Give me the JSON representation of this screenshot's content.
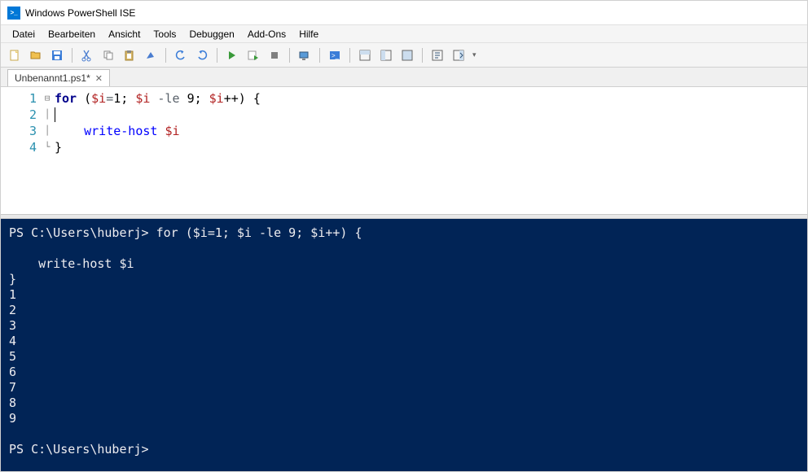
{
  "window": {
    "title": "Windows PowerShell ISE"
  },
  "menu": {
    "items": [
      "Datei",
      "Bearbeiten",
      "Ansicht",
      "Tools",
      "Debuggen",
      "Add-Ons",
      "Hilfe"
    ]
  },
  "tab": {
    "label": "Unbenannt1.ps1*"
  },
  "editor": {
    "line_numbers": [
      "1",
      "2",
      "3",
      "4"
    ],
    "code_lines": [
      {
        "tokens": [
          {
            "t": "for ",
            "c": "kw"
          },
          {
            "t": "(",
            "c": "plain"
          },
          {
            "t": "$i",
            "c": "var"
          },
          {
            "t": "=",
            "c": "op"
          },
          {
            "t": "1",
            "c": "plain"
          },
          {
            "t": "; ",
            "c": "plain"
          },
          {
            "t": "$i",
            "c": "var"
          },
          {
            "t": " -le ",
            "c": "op"
          },
          {
            "t": "9",
            "c": "plain"
          },
          {
            "t": "; ",
            "c": "plain"
          },
          {
            "t": "$i",
            "c": "var"
          },
          {
            "t": "++) {",
            "c": "plain"
          }
        ]
      },
      {
        "tokens": [
          {
            "t": "",
            "c": "plain"
          }
        ],
        "caret": true
      },
      {
        "tokens": [
          {
            "t": "    ",
            "c": "plain"
          },
          {
            "t": "write-host",
            "c": "cmd"
          },
          {
            "t": " ",
            "c": "plain"
          },
          {
            "t": "$i",
            "c": "var"
          }
        ]
      },
      {
        "tokens": [
          {
            "t": "}",
            "c": "plain"
          }
        ]
      }
    ]
  },
  "console": {
    "prompt": "PS C:\\Users\\huberj>",
    "command": "for ($i=1; $i -le 9; $i++) {\n\n    write-host $i\n}",
    "output_lines": [
      "1",
      "2",
      "3",
      "4",
      "5",
      "6",
      "7",
      "8",
      "9"
    ],
    "prompt2": "PS C:\\Users\\huberj>"
  },
  "colors": {
    "console_bg": "#012456",
    "console_fg": "#eeedf0",
    "accent": "#0078d7"
  }
}
